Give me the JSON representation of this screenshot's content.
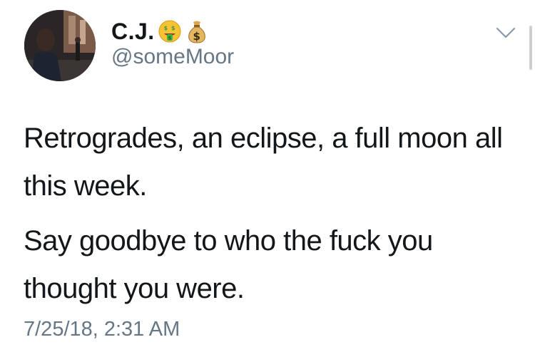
{
  "tweet": {
    "author": {
      "display_name": "C.J.",
      "badges": [
        "money-mouth-face-icon",
        "money-bag-icon"
      ],
      "handle": "@someMoor",
      "avatar": "avatar-photo"
    },
    "menu_icon": "chevron-down-icon",
    "paragraphs": [
      {
        "lines": [
          "Retrogrades, an eclipse, a full moon all",
          "this week."
        ]
      },
      {
        "lines": [
          "Say goodbye to who the fuck you",
          "thought you were."
        ]
      }
    ],
    "timestamp": "7/25/18, 2:31 AM"
  },
  "colors": {
    "text": "#14171a",
    "secondary_text": "#657786",
    "background": "#ffffff"
  }
}
